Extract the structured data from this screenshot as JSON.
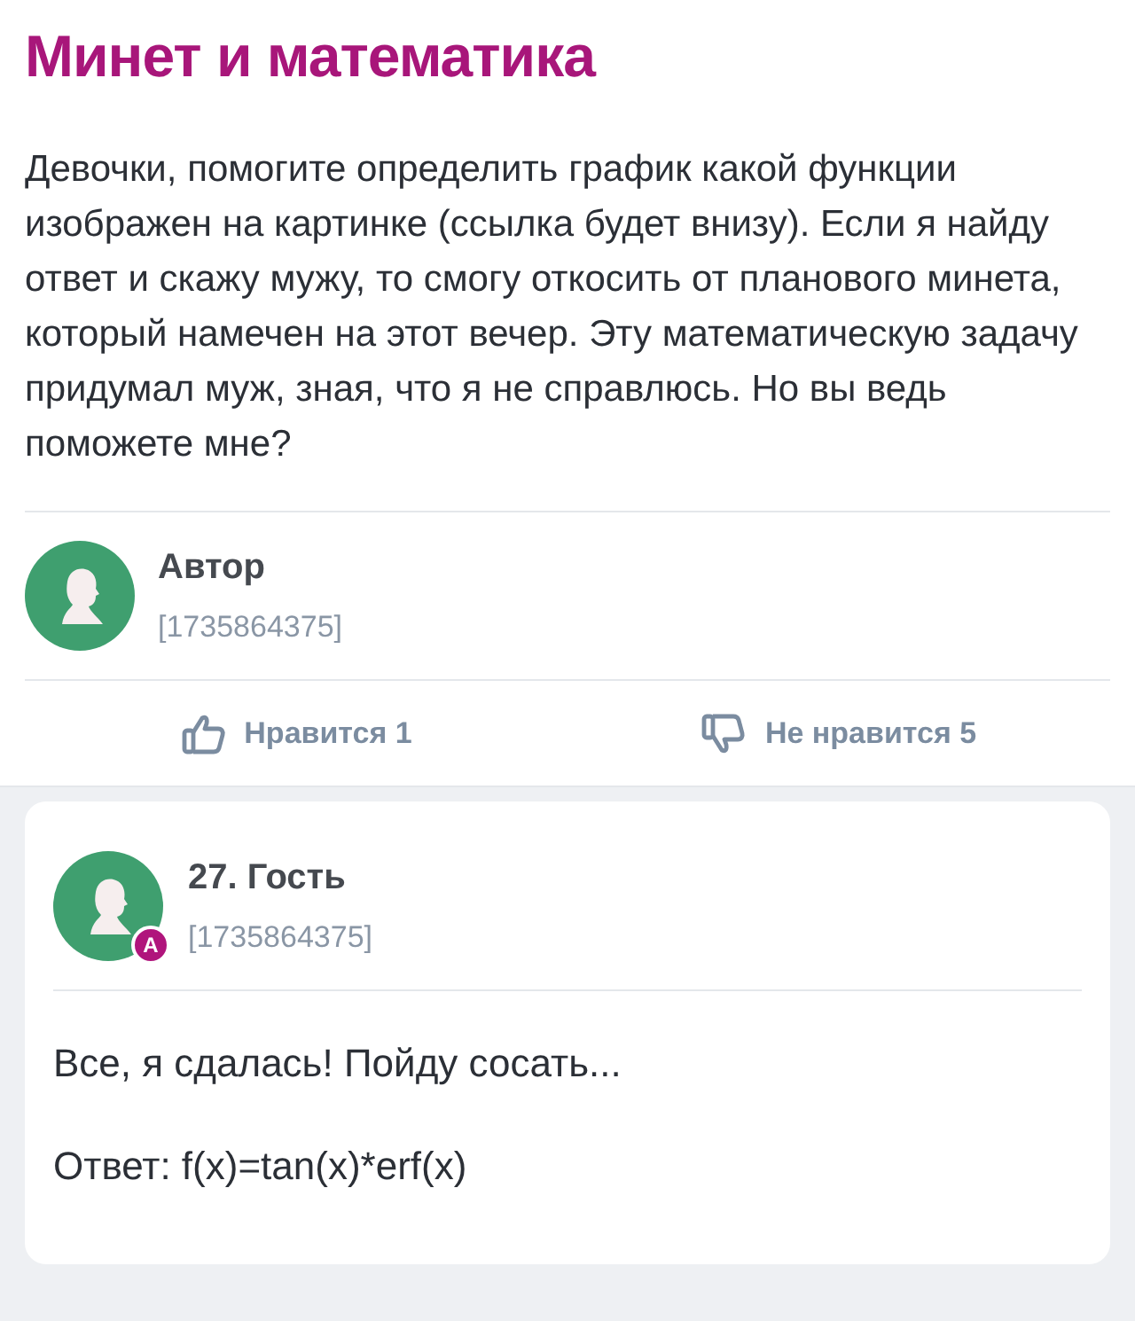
{
  "post": {
    "title": "Минет и математика",
    "body": "Девочки, помогите определить график какой функции изображен на картинке (ссылка будет внизу). Если я найду ответ и скажу мужу, то смогу откосить от планового минета, который намечен на этот вечер. Эту математическую задачу придумал муж, зная, что я не справлюсь. Но вы ведь поможете мне?",
    "author": {
      "name": "Автор",
      "id": "[1735864375]"
    },
    "reactions": [
      {
        "kind": "like",
        "label": "Нравится 1"
      },
      {
        "kind": "dislike",
        "label": "Не нравится 5"
      }
    ]
  },
  "comment": {
    "name": "27. Гость",
    "id": "[1735864375]",
    "badge": "A",
    "lines": [
      "Все, я сдалась! Пойду сосать...",
      "Ответ: f(x)=tan(x)*erf(x)"
    ]
  }
}
